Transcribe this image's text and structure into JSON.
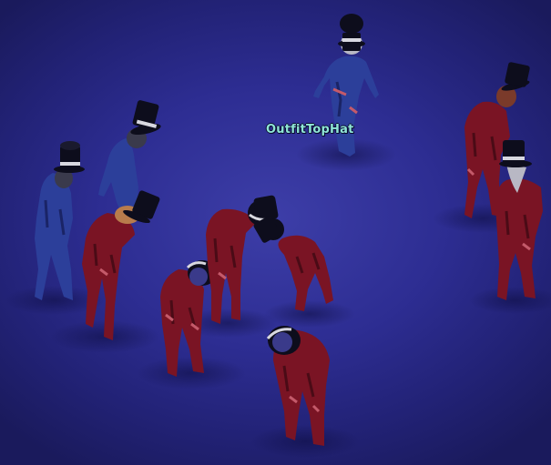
{
  "scene": {
    "label_text": "OutfitTopHat",
    "colors": {
      "floor": "#2d2d92",
      "label": "#8fe6d6",
      "blue_outfit": "#2c3f9a",
      "red_outfit": "#7a1424",
      "hat": "#0d0d1c",
      "hat_band": "#d8d8e0"
    }
  }
}
